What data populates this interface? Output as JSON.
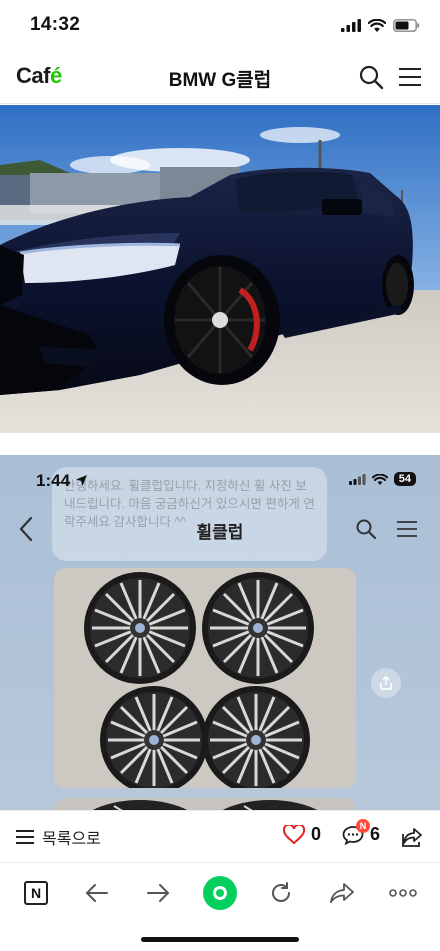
{
  "status_bar": {
    "time": "14:32"
  },
  "header": {
    "logo_text": "Caf",
    "logo_accent": "é",
    "title": "BMW G클럽"
  },
  "post": {
    "inner_screenshot": {
      "time": "1:44",
      "battery": "54",
      "title": "휠클럽",
      "ghost_message": "안녕하세요. 휠클럽입니다. 지정하신 휠 사진 보내드립니다. 마음 궁금하신거 있으시면 편하게 연락주세요 감사합니다 ^^"
    }
  },
  "article_bar": {
    "list_label": "목록으로",
    "like_count": "0",
    "comment_count": "6",
    "new_badge": "N"
  },
  "colors": {
    "naver_green": "#03cf5d",
    "like_red": "#e02424",
    "badge_red": "#ff4b3e"
  }
}
